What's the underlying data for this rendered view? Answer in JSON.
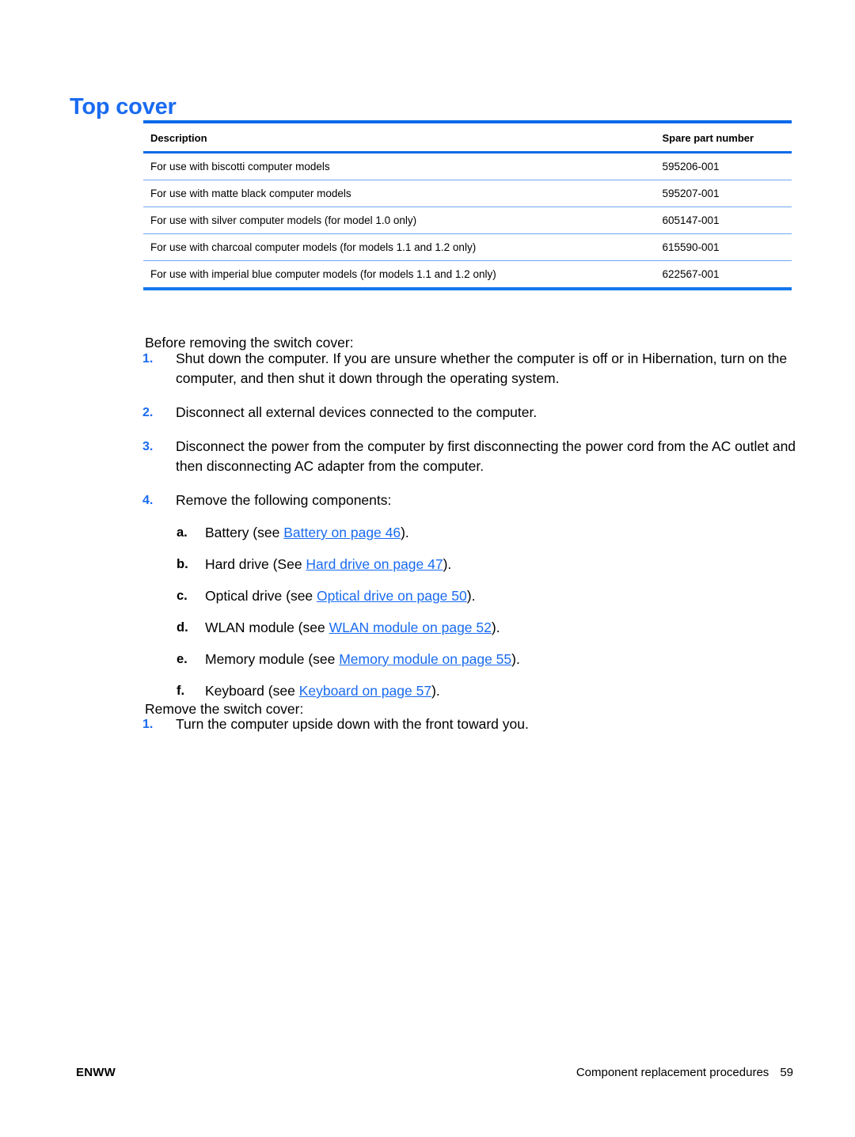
{
  "document": {
    "title": "Top cover"
  },
  "table": {
    "headers": {
      "description": "Description",
      "spare_part_number": "Spare part number"
    },
    "rows": [
      {
        "description": "For use with biscotti computer models",
        "part_number": "595206-001"
      },
      {
        "description": "For use with matte black computer models",
        "part_number": "595207-001"
      },
      {
        "description": "For use with silver computer models (for model 1.0 only)",
        "part_number": "605147-001"
      },
      {
        "description": "For use with charcoal computer models (for models 1.1 and 1.2 only)",
        "part_number": "615590-001"
      },
      {
        "description": "For use with imperial blue computer models (for models 1.1 and 1.2 only)",
        "part_number": "622567-001"
      }
    ]
  },
  "before_section": {
    "lead": "Before removing the switch cover:",
    "steps": [
      {
        "marker": "1.",
        "text": "Shut down the computer. If you are unsure whether the computer is off or in Hibernation, turn on the computer, and then shut it down through the operating system."
      },
      {
        "marker": "2.",
        "text": "Disconnect all external devices connected to the computer."
      },
      {
        "marker": "3.",
        "text": "Disconnect the power from the computer by first disconnecting the power cord from the AC outlet and then disconnecting AC adapter from the computer."
      },
      {
        "marker": "4.",
        "text": "Remove the following components:",
        "substeps": [
          {
            "marker": "a.",
            "prefix": "Battery (see ",
            "link": "Battery on page 46",
            "suffix": ")."
          },
          {
            "marker": "b.",
            "prefix": "Hard drive (See ",
            "link": "Hard drive on page 47",
            "suffix": ")."
          },
          {
            "marker": "c.",
            "prefix": "Optical drive (see ",
            "link": "Optical drive on page 50",
            "suffix": ")."
          },
          {
            "marker": "d.",
            "prefix": "WLAN module (see ",
            "link": "WLAN module on page 52",
            "suffix": ")."
          },
          {
            "marker": "e.",
            "prefix": "Memory module (see ",
            "link": "Memory module on page 55",
            "suffix": ")."
          },
          {
            "marker": "f.",
            "prefix": "Keyboard (see ",
            "link": "Keyboard on page 57",
            "suffix": ")."
          }
        ]
      }
    ]
  },
  "remove_section": {
    "lead": "Remove the switch cover:",
    "steps": [
      {
        "marker": "1.",
        "text": "Turn the computer upside down with the front toward you."
      }
    ]
  },
  "footer": {
    "left": "ENWW",
    "right": "Component replacement procedures",
    "page_number": "59"
  },
  "colors": {
    "heading_blue": "#1a6bf0",
    "table_rule_heavy": "#0a6ae8",
    "table_rule_light": "#6fa8ee",
    "link_blue": "#1a6bf0"
  }
}
